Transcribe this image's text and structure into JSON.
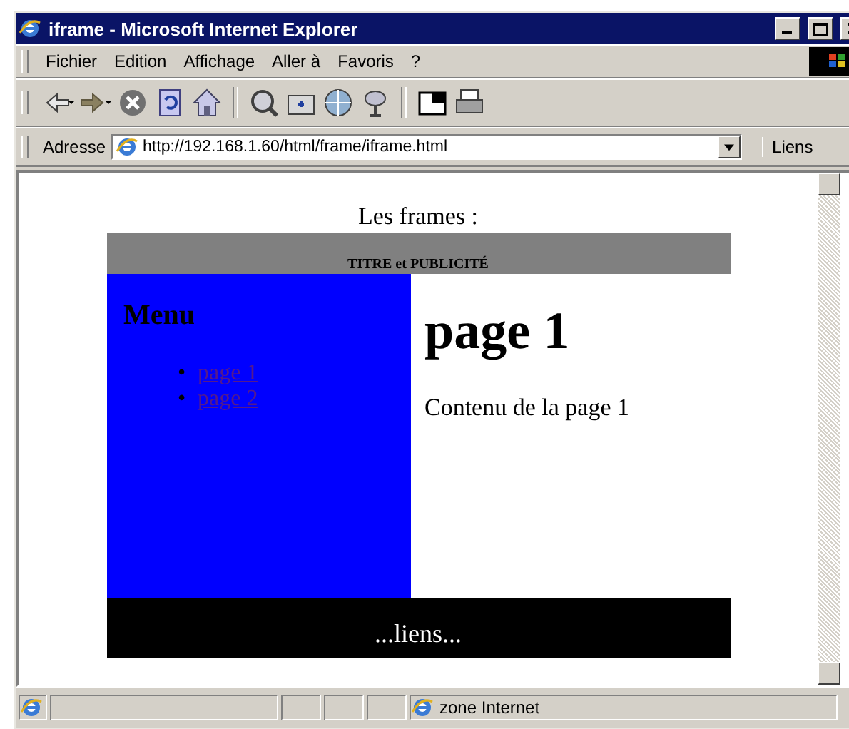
{
  "window": {
    "title": "iframe - Microsoft Internet Explorer"
  },
  "menu_bar": [
    {
      "label": "Fichier"
    },
    {
      "label": "Edition"
    },
    {
      "label": "Affichage"
    },
    {
      "label": "Aller à"
    },
    {
      "label": "Favoris"
    },
    {
      "label": "?"
    }
  ],
  "address_bar": {
    "label": "Adresse",
    "value": "http://192.168.1.60/html/frame/iframe.html",
    "links_label": "Liens"
  },
  "page": {
    "heading": "Les frames :",
    "header_frame": "TITRE et PUBLICITÉ",
    "menu_frame": {
      "title": "Menu",
      "links": [
        {
          "bullet": "•",
          "label": "page 1"
        },
        {
          "bullet": "•",
          "label": "page 2"
        }
      ]
    },
    "main_frame": {
      "title": "page 1",
      "text": "Contenu de la page 1"
    },
    "footer_frame": "...liens..."
  },
  "status_bar": {
    "zone": "zone Internet"
  }
}
